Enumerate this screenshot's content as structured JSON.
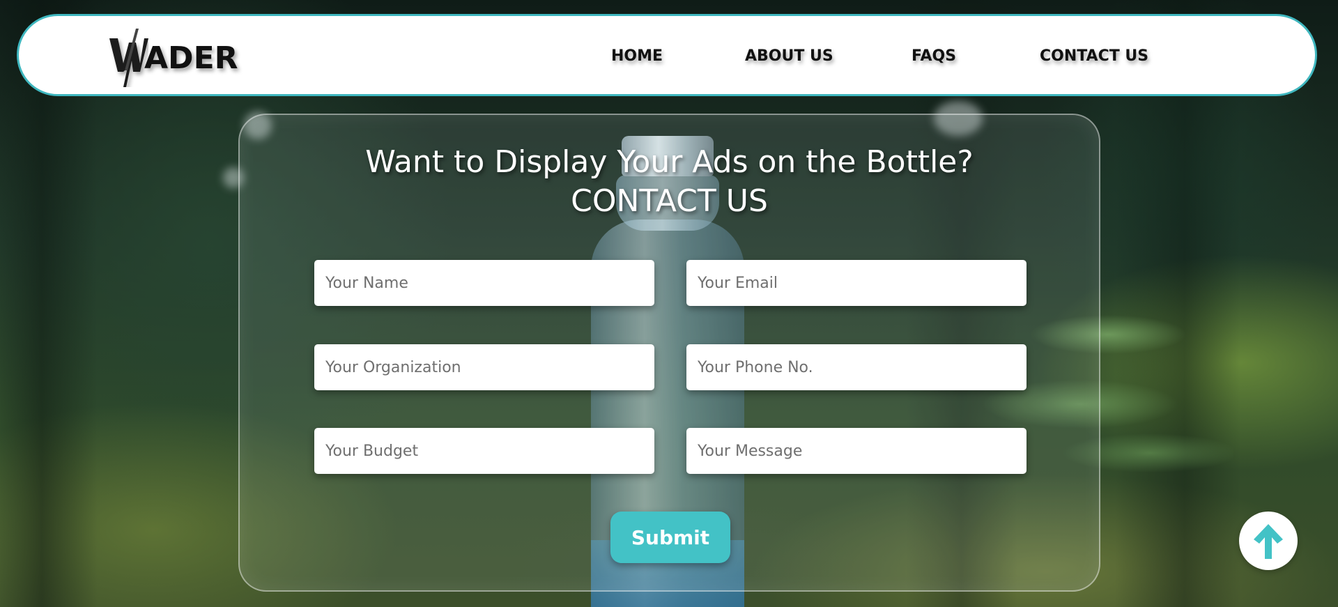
{
  "brand": {
    "logo_letter": "W",
    "logo_rest": "ADER"
  },
  "nav": {
    "items": [
      {
        "label": "HOME"
      },
      {
        "label": "ABOUT US"
      },
      {
        "label": "FAQS"
      },
      {
        "label": "CONTACT US"
      }
    ]
  },
  "form": {
    "heading_line1": "Want to Display Your Ads on the Bottle?",
    "heading_line2": "CONTACT US",
    "fields": [
      {
        "placeholder": "Your Name",
        "value": ""
      },
      {
        "placeholder": "Your Email",
        "value": ""
      },
      {
        "placeholder": "Your Organization",
        "value": ""
      },
      {
        "placeholder": "Your Phone No.",
        "value": ""
      },
      {
        "placeholder": "Your Budget",
        "value": ""
      },
      {
        "placeholder": "Your Message",
        "value": ""
      }
    ],
    "submit_label": "Submit"
  },
  "icons": {
    "scroll_top": "arrow-up-icon"
  },
  "colors": {
    "accent": "#43c2c6",
    "nav_border": "#3fb7bf",
    "text_dark": "#111111",
    "white": "#ffffff"
  }
}
